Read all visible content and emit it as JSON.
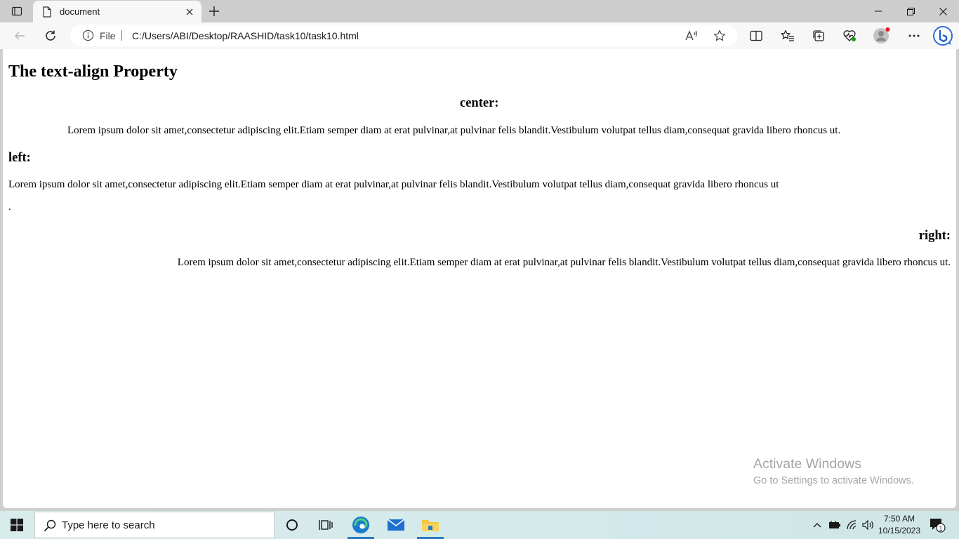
{
  "browser": {
    "tab": {
      "title": "document"
    },
    "address_bar": {
      "scheme_label": "File",
      "url": "C:/Users/ABI/Desktop/RAASHID/task10/task10.html"
    },
    "colors": {
      "accent": "#2b79c2",
      "profile_dot": "#e81123"
    }
  },
  "page": {
    "heading": "The text-align Property",
    "sections": [
      {
        "heading": "center:",
        "text": "Lorem ipsum dolor sit amet,consectetur adipiscing elit.Etiam semper diam at erat pulvinar,at pulvinar felis blandit.Vestibulum volutpat tellus diam,consequat gravida libero rhoncus ut."
      },
      {
        "heading": "left:",
        "text": "Lorem ipsum dolor sit amet,consectetur adipiscing elit.Etiam semper diam at erat pulvinar,at pulvinar felis blandit.Vestibulum volutpat tellus diam,consequat gravida libero rhoncus ut",
        "trailing": "."
      },
      {
        "heading": "right:",
        "text": "Lorem ipsum dolor sit amet,consectetur adipiscing elit.Etiam semper diam at erat pulvinar,at pulvinar felis blandit.Vestibulum volutpat tellus diam,consequat gravida libero rhoncus ut."
      }
    ]
  },
  "watermark": {
    "title": "Activate Windows",
    "subtitle": "Go to Settings to activate Windows."
  },
  "taskbar": {
    "search_placeholder": "Type here to search",
    "time": "7:50 AM",
    "date": "10/15/2023",
    "notification_count": "1"
  }
}
